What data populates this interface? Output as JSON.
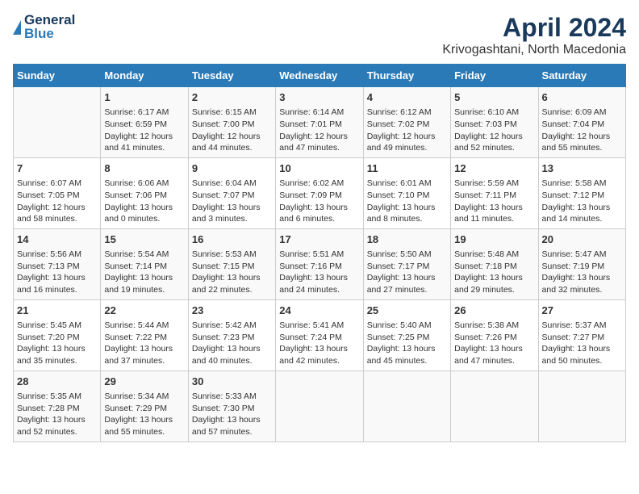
{
  "logo": {
    "general": "General",
    "blue": "Blue"
  },
  "title": "April 2024",
  "subtitle": "Krivogashtani, North Macedonia",
  "days_of_week": [
    "Sunday",
    "Monday",
    "Tuesday",
    "Wednesday",
    "Thursday",
    "Friday",
    "Saturday"
  ],
  "weeks": [
    [
      {
        "day": "",
        "info": ""
      },
      {
        "day": "1",
        "info": "Sunrise: 6:17 AM\nSunset: 6:59 PM\nDaylight: 12 hours\nand 41 minutes."
      },
      {
        "day": "2",
        "info": "Sunrise: 6:15 AM\nSunset: 7:00 PM\nDaylight: 12 hours\nand 44 minutes."
      },
      {
        "day": "3",
        "info": "Sunrise: 6:14 AM\nSunset: 7:01 PM\nDaylight: 12 hours\nand 47 minutes."
      },
      {
        "day": "4",
        "info": "Sunrise: 6:12 AM\nSunset: 7:02 PM\nDaylight: 12 hours\nand 49 minutes."
      },
      {
        "day": "5",
        "info": "Sunrise: 6:10 AM\nSunset: 7:03 PM\nDaylight: 12 hours\nand 52 minutes."
      },
      {
        "day": "6",
        "info": "Sunrise: 6:09 AM\nSunset: 7:04 PM\nDaylight: 12 hours\nand 55 minutes."
      }
    ],
    [
      {
        "day": "7",
        "info": "Sunrise: 6:07 AM\nSunset: 7:05 PM\nDaylight: 12 hours\nand 58 minutes."
      },
      {
        "day": "8",
        "info": "Sunrise: 6:06 AM\nSunset: 7:06 PM\nDaylight: 13 hours\nand 0 minutes."
      },
      {
        "day": "9",
        "info": "Sunrise: 6:04 AM\nSunset: 7:07 PM\nDaylight: 13 hours\nand 3 minutes."
      },
      {
        "day": "10",
        "info": "Sunrise: 6:02 AM\nSunset: 7:09 PM\nDaylight: 13 hours\nand 6 minutes."
      },
      {
        "day": "11",
        "info": "Sunrise: 6:01 AM\nSunset: 7:10 PM\nDaylight: 13 hours\nand 8 minutes."
      },
      {
        "day": "12",
        "info": "Sunrise: 5:59 AM\nSunset: 7:11 PM\nDaylight: 13 hours\nand 11 minutes."
      },
      {
        "day": "13",
        "info": "Sunrise: 5:58 AM\nSunset: 7:12 PM\nDaylight: 13 hours\nand 14 minutes."
      }
    ],
    [
      {
        "day": "14",
        "info": "Sunrise: 5:56 AM\nSunset: 7:13 PM\nDaylight: 13 hours\nand 16 minutes."
      },
      {
        "day": "15",
        "info": "Sunrise: 5:54 AM\nSunset: 7:14 PM\nDaylight: 13 hours\nand 19 minutes."
      },
      {
        "day": "16",
        "info": "Sunrise: 5:53 AM\nSunset: 7:15 PM\nDaylight: 13 hours\nand 22 minutes."
      },
      {
        "day": "17",
        "info": "Sunrise: 5:51 AM\nSunset: 7:16 PM\nDaylight: 13 hours\nand 24 minutes."
      },
      {
        "day": "18",
        "info": "Sunrise: 5:50 AM\nSunset: 7:17 PM\nDaylight: 13 hours\nand 27 minutes."
      },
      {
        "day": "19",
        "info": "Sunrise: 5:48 AM\nSunset: 7:18 PM\nDaylight: 13 hours\nand 29 minutes."
      },
      {
        "day": "20",
        "info": "Sunrise: 5:47 AM\nSunset: 7:19 PM\nDaylight: 13 hours\nand 32 minutes."
      }
    ],
    [
      {
        "day": "21",
        "info": "Sunrise: 5:45 AM\nSunset: 7:20 PM\nDaylight: 13 hours\nand 35 minutes."
      },
      {
        "day": "22",
        "info": "Sunrise: 5:44 AM\nSunset: 7:22 PM\nDaylight: 13 hours\nand 37 minutes."
      },
      {
        "day": "23",
        "info": "Sunrise: 5:42 AM\nSunset: 7:23 PM\nDaylight: 13 hours\nand 40 minutes."
      },
      {
        "day": "24",
        "info": "Sunrise: 5:41 AM\nSunset: 7:24 PM\nDaylight: 13 hours\nand 42 minutes."
      },
      {
        "day": "25",
        "info": "Sunrise: 5:40 AM\nSunset: 7:25 PM\nDaylight: 13 hours\nand 45 minutes."
      },
      {
        "day": "26",
        "info": "Sunrise: 5:38 AM\nSunset: 7:26 PM\nDaylight: 13 hours\nand 47 minutes."
      },
      {
        "day": "27",
        "info": "Sunrise: 5:37 AM\nSunset: 7:27 PM\nDaylight: 13 hours\nand 50 minutes."
      }
    ],
    [
      {
        "day": "28",
        "info": "Sunrise: 5:35 AM\nSunset: 7:28 PM\nDaylight: 13 hours\nand 52 minutes."
      },
      {
        "day": "29",
        "info": "Sunrise: 5:34 AM\nSunset: 7:29 PM\nDaylight: 13 hours\nand 55 minutes."
      },
      {
        "day": "30",
        "info": "Sunrise: 5:33 AM\nSunset: 7:30 PM\nDaylight: 13 hours\nand 57 minutes."
      },
      {
        "day": "",
        "info": ""
      },
      {
        "day": "",
        "info": ""
      },
      {
        "day": "",
        "info": ""
      },
      {
        "day": "",
        "info": ""
      }
    ]
  ]
}
